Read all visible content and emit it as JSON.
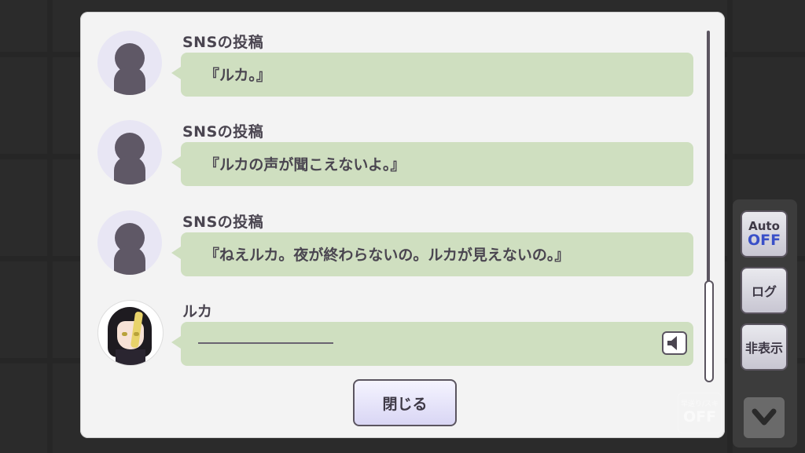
{
  "log": {
    "entries": [
      {
        "speaker": "SNSの投稿",
        "text": "『ルカ。』",
        "avatar": "silhouette-icon"
      },
      {
        "speaker": "SNSの投稿",
        "text": "『ルカの声が聞こえないよ。』",
        "avatar": "silhouette-icon"
      },
      {
        "speaker": "SNSの投稿",
        "text": "『ねえルカ。夜が終わらないの。ルカが見えないの。』",
        "avatar": "silhouette-icon"
      },
      {
        "speaker": "ルカ",
        "text": "",
        "avatar": "character-portrait"
      }
    ],
    "close_label": "閉じる"
  },
  "side_panel": {
    "auto_label": "Auto",
    "auto_state": "OFF",
    "log_label": "ログ",
    "hide_label": "非表示"
  },
  "skip": {
    "label": "早送り/スキ",
    "state": "OFF"
  },
  "colors": {
    "bubble": "#cfdfc0",
    "text": "#4a4550",
    "auto_off": "#3a50c8"
  }
}
